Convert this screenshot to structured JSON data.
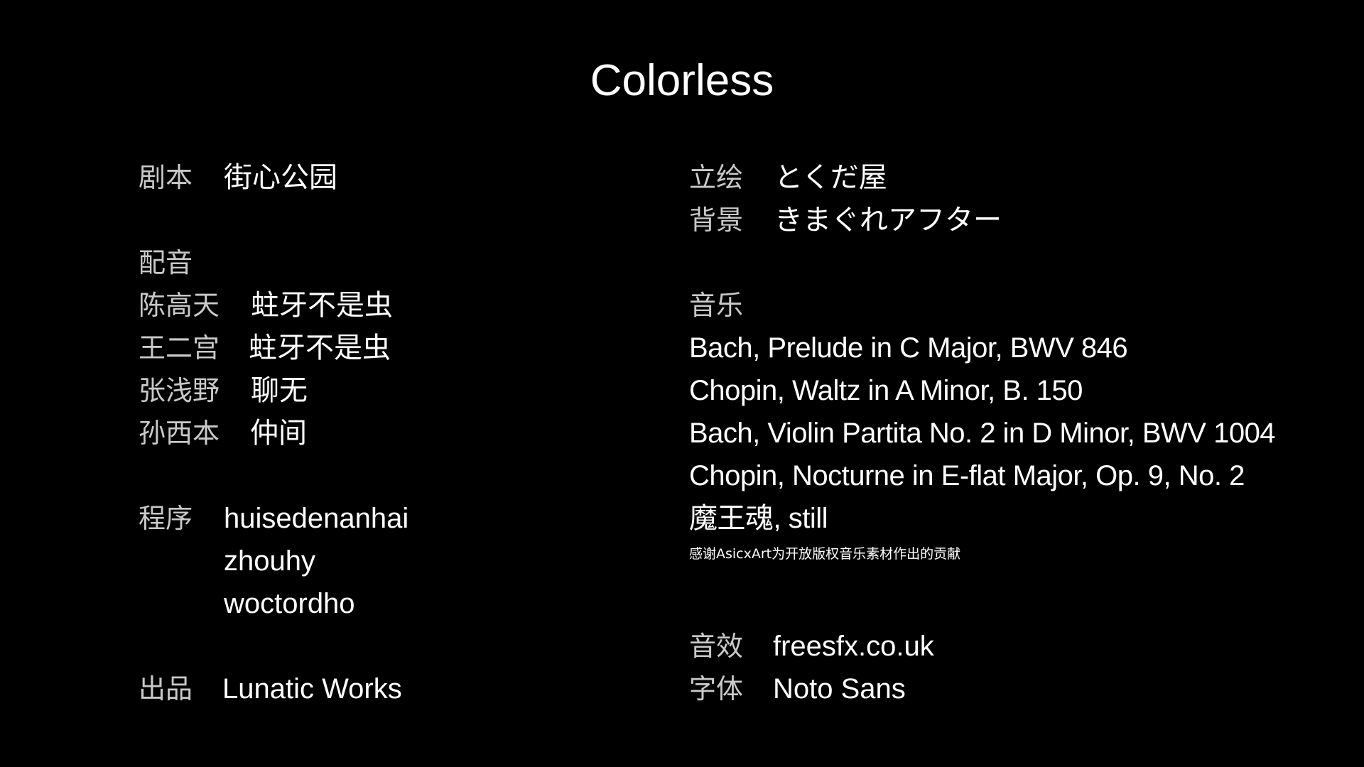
{
  "title": "Colorless",
  "left": {
    "script": {
      "label": "剧本",
      "value": "街心公园"
    },
    "voice": {
      "heading": "配音",
      "cast": [
        {
          "role": "陈高天",
          "actor": "蛀牙不是虫"
        },
        {
          "role": "王二宫",
          "actor": "蛀牙不是虫"
        },
        {
          "role": "张浅野",
          "actor": "聊无"
        },
        {
          "role": "孙西本",
          "actor": "仲间"
        }
      ]
    },
    "program": {
      "label": "程序",
      "members": [
        "huisedenanhai",
        "zhouhy",
        "woctordho"
      ]
    },
    "publisher": {
      "label": "出品",
      "value": "Lunatic Works"
    }
  },
  "right": {
    "art": {
      "label": "立绘",
      "value": "とくだ屋"
    },
    "background": {
      "label": "背景",
      "value": "きまぐれアフター"
    },
    "music": {
      "heading": "音乐",
      "tracks": [
        "Bach, Prelude in C Major, BWV 846",
        "Chopin, Waltz in A Minor, B. 150",
        "Bach, Violin Partita No. 2 in D Minor, BWV 1004",
        "Chopin, Nocturne in E-flat Major, Op. 9, No. 2",
        "魔王魂, still"
      ],
      "thanks": "感谢AsicxArt为开放版权音乐素材作出的贡献"
    },
    "sfx": {
      "label": "音效",
      "value": "freesfx.co.uk"
    },
    "font": {
      "label": "字体",
      "value": "Noto Sans"
    }
  },
  "colors": {
    "background": "#000000",
    "label": "#c9c9c9",
    "value": "#ffffff"
  }
}
